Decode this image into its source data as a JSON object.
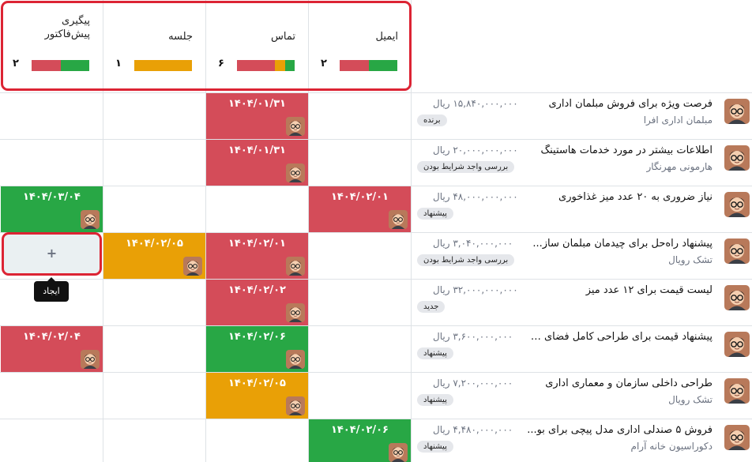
{
  "colors": {
    "overdue": "#d44c59",
    "today": "#e9a006",
    "planned": "#28a745",
    "highlight": "#dc2434"
  },
  "columns": [
    {
      "key": "email",
      "title": "ایمیل",
      "count": "۲",
      "bar": {
        "overdue": 0.5,
        "today": 0,
        "planned": 0.5
      }
    },
    {
      "key": "call",
      "title": "تماس",
      "count": "۶",
      "bar": {
        "overdue": 0.66,
        "today": 0.17,
        "planned": 0.17
      }
    },
    {
      "key": "meeting",
      "title": "جلسه",
      "count": "۱",
      "bar": {
        "overdue": 0,
        "today": 1,
        "planned": 0
      }
    },
    {
      "key": "quote",
      "title": "پیگیری پیش‌فاکتور",
      "title_lines": [
        "پیگیری",
        "پیش‌فاکتور"
      ],
      "count": "۲",
      "bar": {
        "overdue": 0.5,
        "today": 0,
        "planned": 0.5
      }
    }
  ],
  "rows": [
    {
      "name": "فرصت ویژه برای فروش مبلمان اداری",
      "customer": "مبلمان اداری افرا",
      "amount": "۱۵,۸۴۰,۰۰۰,۰۰۰ ریال",
      "stage": "برنده",
      "activities": {
        "call": {
          "date": "۱۴۰۴/۰۱/۳۱",
          "status": "overdue"
        }
      }
    },
    {
      "name": "اطلاعات بیشتر در مورد خدمات هاستینگ",
      "customer": "هارمونی مهرنگار",
      "amount": "۲۰,۰۰۰,۰۰۰,۰۰۰ ریال",
      "stage": "بررسی واجد شرایط بودن",
      "activities": {
        "call": {
          "date": "۱۴۰۴/۰۱/۳۱",
          "status": "overdue"
        }
      }
    },
    {
      "name": "نیاز ضروری به ۲۰ عدد میز غذاخوری",
      "customer": "",
      "amount": "۴۸,۰۰۰,۰۰۰,۰۰۰ ریال",
      "stage": "پیشنهاد",
      "activities": {
        "email": {
          "date": "۱۴۰۴/۰۲/۰۱",
          "status": "overdue"
        },
        "quote": {
          "date": "۱۴۰۴/۰۳/۰۴",
          "status": "planned"
        }
      }
    },
    {
      "name": "پیشنهاد راه‌حل برای چیدمان مبلمان ساز...",
      "customer": "تشک رویال",
      "amount": "۳,۰۴۰,۰۰۰,۰۰۰ ریال",
      "stage": "بررسی واجد شرایط بودن",
      "activities": {
        "call": {
          "date": "۱۴۰۴/۰۲/۰۱",
          "status": "overdue"
        },
        "meeting": {
          "date": "۱۴۰۴/۰۲/۰۵",
          "status": "today"
        }
      }
    },
    {
      "name": "لیست قیمت برای ۱۲ عدد میز",
      "customer": "",
      "amount": "۳۲,۰۰۰,۰۰۰,۰۰۰ ریال",
      "stage": "جدید",
      "activities": {
        "call": {
          "date": "۱۴۰۴/۰۲/۰۲",
          "status": "overdue"
        }
      }
    },
    {
      "name": "پیشنهاد قیمت برای طراحی کامل فضای ب...",
      "customer": "",
      "amount": "۳,۶۰۰,۰۰۰,۰۰۰ ریال",
      "stage": "پیشنهاد",
      "activities": {
        "call": {
          "date": "۱۴۰۴/۰۲/۰۶",
          "status": "planned"
        },
        "quote": {
          "date": "۱۴۰۴/۰۲/۰۴",
          "status": "overdue"
        }
      }
    },
    {
      "name": "طراحی داخلی سازمان و معماری اداری",
      "customer": "تشک رویال",
      "amount": "۷,۲۰۰,۰۰۰,۰۰۰ ریال",
      "stage": "پیشنهاد",
      "activities": {
        "call": {
          "date": "۱۴۰۴/۰۲/۰۵",
          "status": "today"
        }
      }
    },
    {
      "name": "فروش ۵ صندلی اداری مدل پیچی برای بو...",
      "customer": "دکوراسیون خانه آرام",
      "amount": "۴,۴۸۰,۰۰۰,۰۰۰ ریال",
      "stage": "پیشنهاد",
      "activities": {
        "email": {
          "date": "۱۴۰۴/۰۲/۰۶",
          "status": "planned"
        }
      }
    }
  ],
  "create_cell": {
    "plus": "+",
    "tooltip": "ایجاد"
  }
}
